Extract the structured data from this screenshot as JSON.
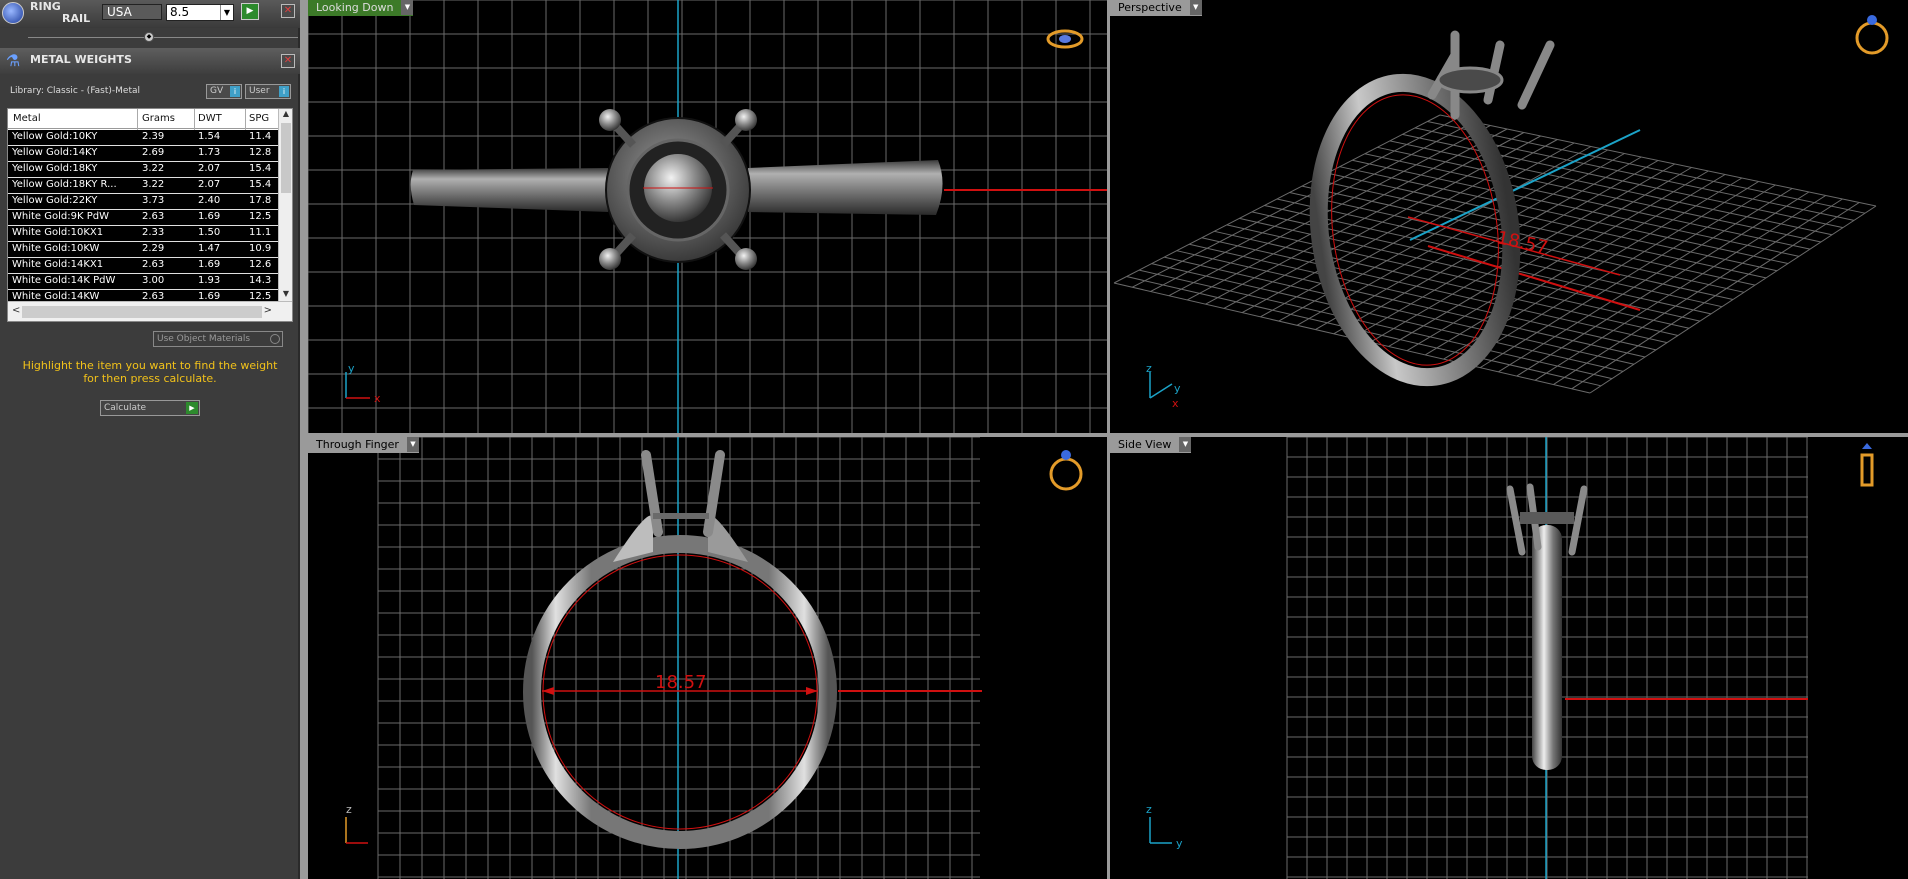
{
  "ring_rail": {
    "title_line1": "RING",
    "title_line2": "RAIL",
    "country": "USA",
    "size": "8.5"
  },
  "metal_weights": {
    "title": "METAL WEIGHTS",
    "library": "Library: Classic - (Fast)-Metal",
    "gv_toggle": "GV",
    "user_toggle": "User",
    "columns": [
      "Metal",
      "Grams",
      "DWT",
      "SPG"
    ],
    "rows": [
      [
        "Yellow Gold:10KY",
        "2.39",
        "1.54",
        "11.4"
      ],
      [
        "Yellow Gold:14KY",
        "2.69",
        "1.73",
        "12.8"
      ],
      [
        "Yellow Gold:18KY",
        "3.22",
        "2.07",
        "15.4"
      ],
      [
        "Yellow Gold:18KY R...",
        "3.22",
        "2.07",
        "15.4"
      ],
      [
        "Yellow Gold:22KY",
        "3.73",
        "2.40",
        "17.8"
      ],
      [
        "White Gold:9K PdW",
        "2.63",
        "1.69",
        "12.5"
      ],
      [
        "White Gold:10KX1",
        "2.33",
        "1.50",
        "11.1"
      ],
      [
        "White Gold:10KW",
        "2.29",
        "1.47",
        "10.9"
      ],
      [
        "White Gold:14KX1",
        "2.63",
        "1.69",
        "12.6"
      ],
      [
        "White Gold:14K PdW",
        "3.00",
        "1.93",
        "14.3"
      ],
      [
        "White Gold:14KW",
        "2.63",
        "1.69",
        "12.5"
      ]
    ],
    "use_object_materials": "Use Object Materials",
    "hint": "Highlight the item you want to find the weight for then press calculate.",
    "calculate": "Calculate"
  },
  "viewports": {
    "top_left": "Looking Down",
    "top_right": "Perspective",
    "bottom_left": "Through Finger",
    "bottom_right": "Side View"
  },
  "measurement": "18.57",
  "axis": {
    "x": "x",
    "y": "y",
    "z": "z"
  },
  "colors": {
    "accent_green": "#3c7a28",
    "hint_yellow": "#f2c21a",
    "axis_red": "#d01010",
    "axis_cyan": "#1ba3c8"
  }
}
